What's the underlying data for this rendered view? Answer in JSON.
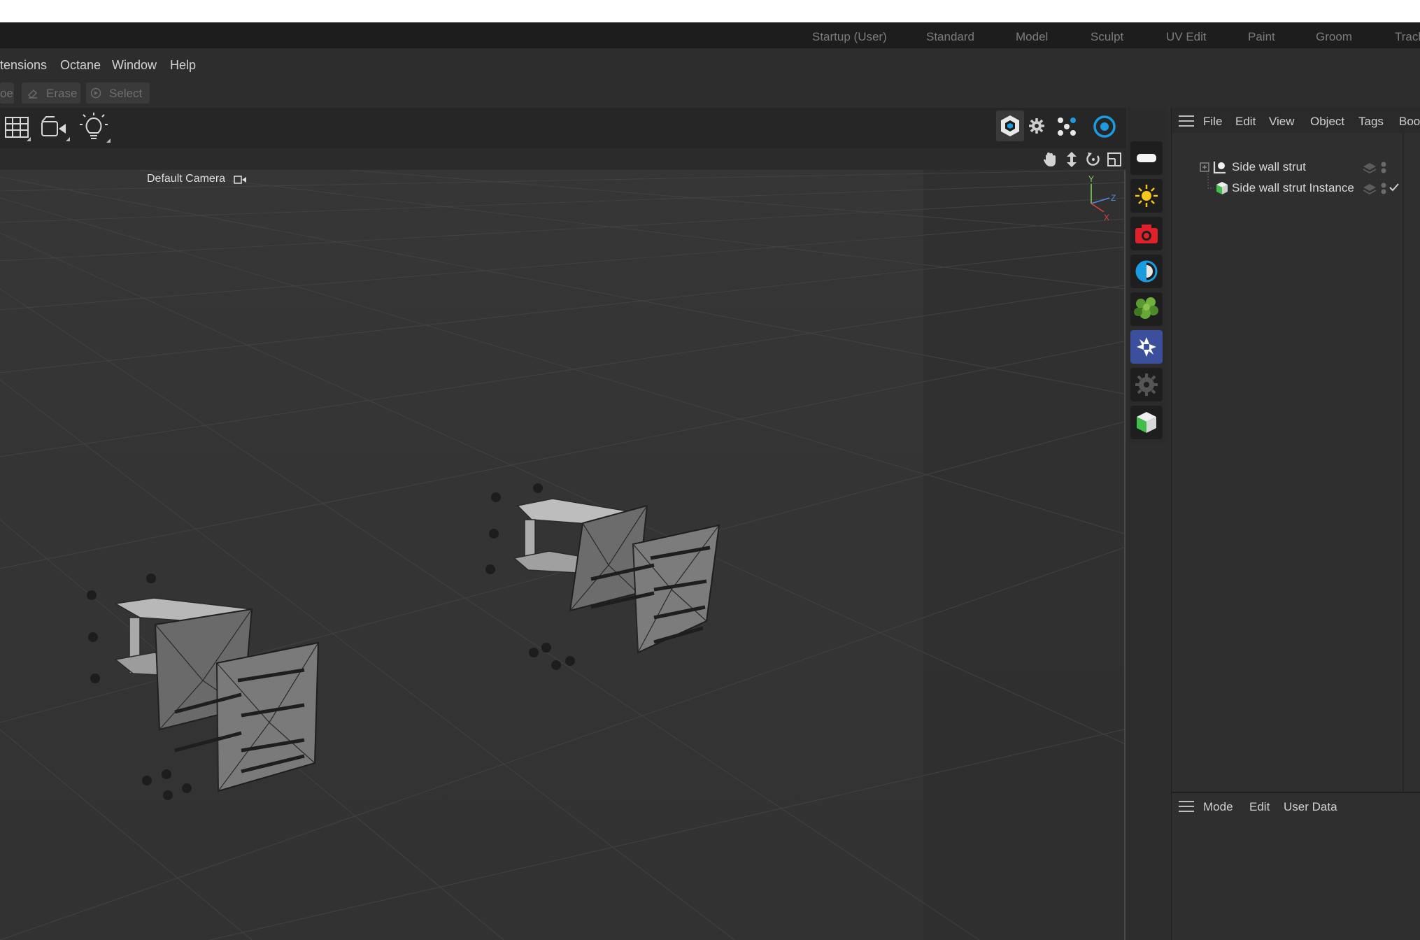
{
  "layouts": [
    "Startup (User)",
    "Standard",
    "Model",
    "Sculpt",
    "UV Edit",
    "Paint",
    "Groom",
    "Track"
  ],
  "menu": [
    "tensions",
    "Octane",
    "Window",
    "Help"
  ],
  "tools": {
    "partial_label": "oe",
    "erase_label": "Erase",
    "select_label": "Select"
  },
  "viewport": {
    "camera_label": "Default Camera",
    "axes": {
      "y": "Y",
      "z": "Z",
      "x": "X"
    }
  },
  "palette_icons": [
    "light-bar-icon",
    "sun-icon",
    "camera-icon",
    "contrast-icon",
    "scatter-icon",
    "octane-icon",
    "gear-icon",
    "instance-cube-icon"
  ],
  "object_manager": {
    "menu": [
      "File",
      "Edit",
      "View",
      "Object",
      "Tags",
      "Bool"
    ],
    "items": [
      {
        "name": "Side wall strut"
      },
      {
        "name": "Side wall strut Instance"
      }
    ]
  },
  "attribute_manager": {
    "menu": [
      "Mode",
      "Edit",
      "User Data"
    ]
  },
  "colors": {
    "octane_blue": "#1b9be0",
    "accent_red": "#e0202a",
    "instance_green": "#3fbf4a"
  }
}
